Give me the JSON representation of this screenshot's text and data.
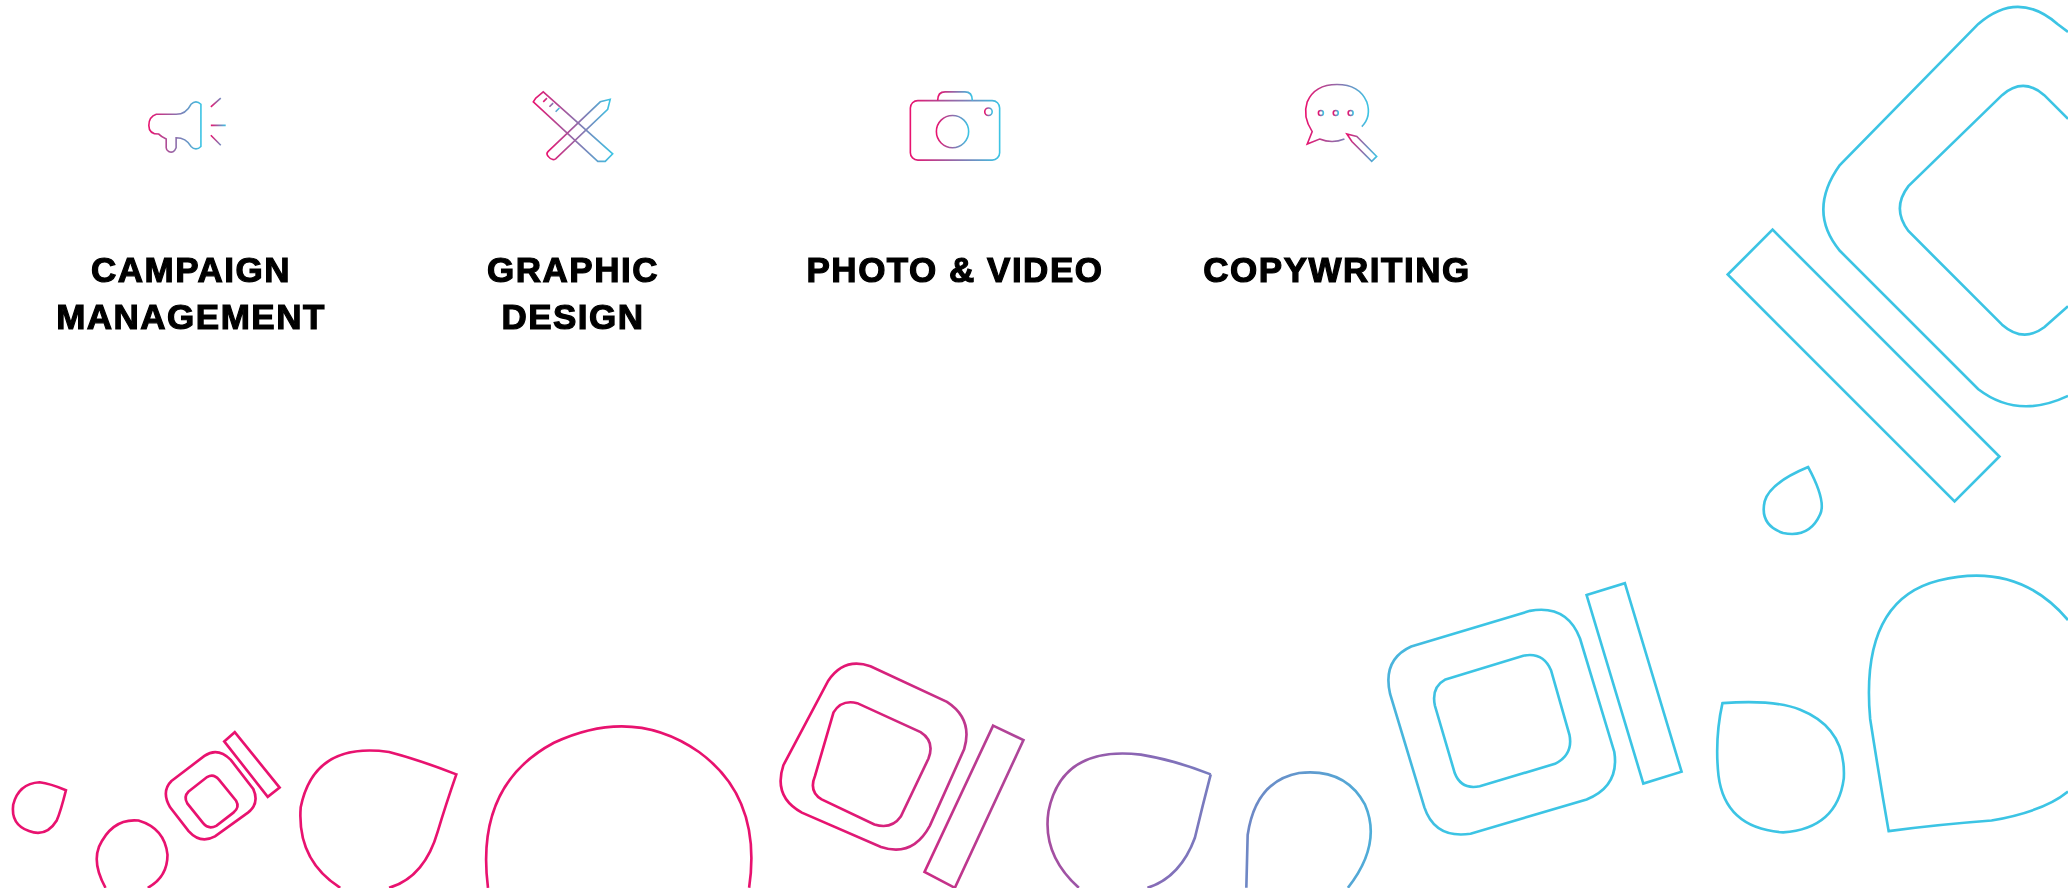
{
  "services": [
    {
      "title_lines": [
        "CAMPAIGN",
        "MANAGEMENT"
      ]
    },
    {
      "title_lines": [
        "GRAPHIC",
        "DESIGN"
      ]
    },
    {
      "title_lines": [
        "PHOTO & VIDEO"
      ]
    },
    {
      "title_lines": [
        "COPYWRITING"
      ]
    }
  ]
}
